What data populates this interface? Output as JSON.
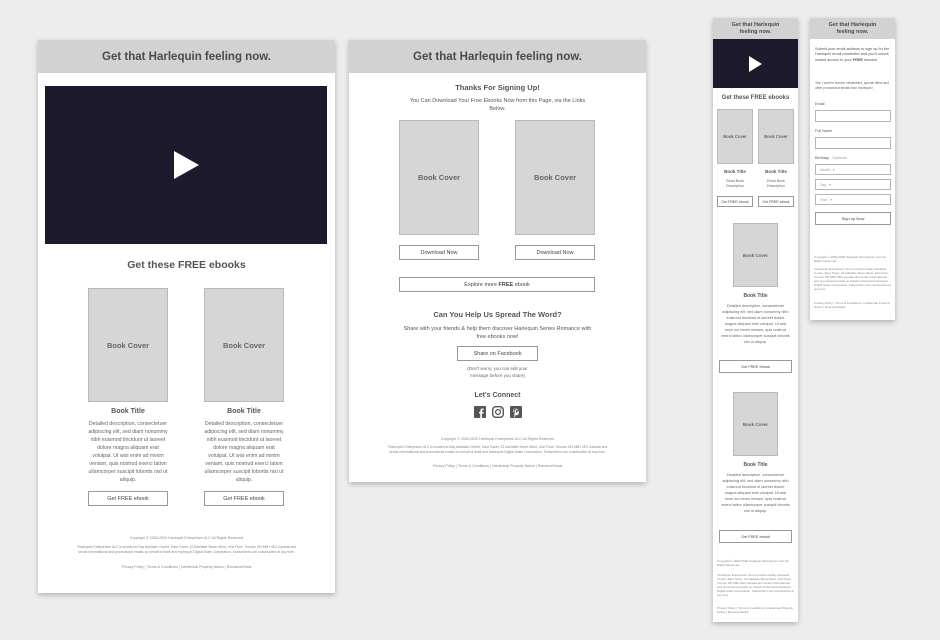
{
  "header_title": "Get that Harlequin feeling now.",
  "mobile_header_title": "Get that Harlequin feeling now.",
  "colors": {
    "header_bg": "#d2d2d2",
    "video_bg": "#1d1a2e",
    "cover_bg": "#d6d6d6"
  },
  "free_ebooks_heading": "Get these FREE ebooks",
  "book": {
    "cover": "Book Cover",
    "title": "Book Title",
    "description": "Detailed description, consectetuer adipiscing elit, sed diam nonummy nibh euismod tincidunt ut laoreet dolore magna aliquam erat volutpat. Ut wisi enim ad minim veniam, quis nostrud exerci tation ullamcorper suscipit lobortis nisl ut aliquip.",
    "short_description": "Read Book Description",
    "get_button": "Get FREE ebook"
  },
  "thanks": {
    "heading": "Thanks For Signing Up!",
    "subtext": "You Can Download Your Free Ebooks Now from this Page, via the Links Below.",
    "download_button": "Download Now",
    "explore_pre": "Explore more ",
    "explore_bold": "FREE",
    "explore_post": " ebook",
    "spread_heading": "Can You Help Us Spread The Word?",
    "spread_text": "Share with your friends & help them discover Harlequin Series Romance with free ebooks now!",
    "share_button": "Share on Facebook",
    "share_note": "(Don't worry, you can edit your message before you share)",
    "connect_heading": "Let's Connect"
  },
  "signup": {
    "intro_pre": "Submit your email address to sign up for the Harlequin email newsletter and you'll unlock instant access to your ",
    "intro_bold": "FREE",
    "intro_post": " ebooks!",
    "consent": "Yes! I want to receive newsletters, special offers and other promotional emails from Harlequin!",
    "email_label": "Email",
    "name_label": "Full Name",
    "birthday_label": "Birthday",
    "optional": " - Optional",
    "month": "Month",
    "day": "Day",
    "year": "Year",
    "submit": "Sign up Now"
  },
  "footer": {
    "copyright": "Copyright © 2000-2020 Harlequin Enterprises ULC All Rights Reserved",
    "address": "*Harlequin Enterprises ULC is located at Bay Adelaide Centre, East Tower, 22 Adelaide Street West, 41st Floor, Toronto ON M5H 4E3 Canada and sends informational and promotional emails on behalf of itself and Harlequin Digital Sales Corporation. Subscribers can unsubscribe at any time.",
    "links": "Privacy Policy | Terms & Conditions | Intellectual Property Notice | RomanceDeals"
  }
}
